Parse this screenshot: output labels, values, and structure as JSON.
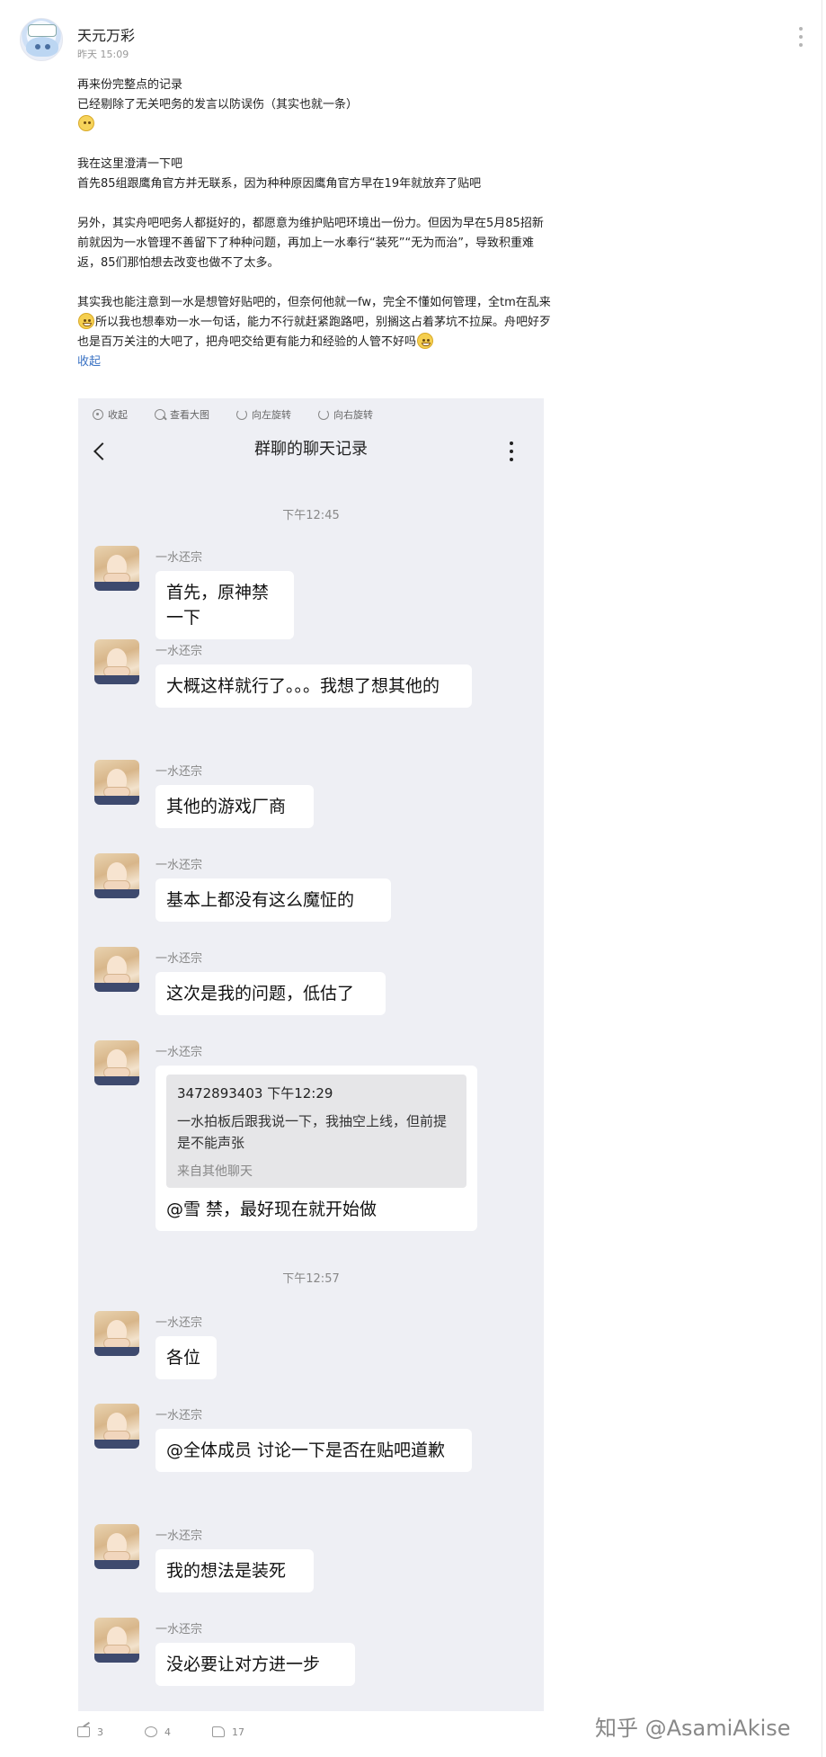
{
  "post": {
    "username": "天元万彩",
    "time": "昨天 15:09",
    "lines1": [
      "再来份完整点的记录",
      "已经剔除了无关吧务的发言以防误伤（其实也就一条）"
    ],
    "para2": [
      "我在这里澄清一下吧",
      "首先85组跟鹰角官方并无联系，因为种种原因鹰角官方早在19年就放弃了贴吧"
    ],
    "para3": "另外，其实舟吧吧务人都挺好的，都愿意为维护贴吧环境出一份力。但因为早在5月85招新前就因为一水管理不善留下了种种问题，再加上一水奉行“装死”“无为而治”，导致积重难返，85们那怕想去改变也做不了太多。",
    "para4_a": "其实我也能注意到一水是想管好贴吧的，但奈何他就一fw，完全不懂如何管理，全tm在乱来",
    "para4_b": "所以我也想奉劝一水一句话，能力不行就赶紧跑路吧，别搁这占着茅坑不拉屎。舟吧好歹也是百万关注的大吧了，把舟吧交给更有能力和经验的人管不好吗",
    "collapse": "收起"
  },
  "viewer": {
    "toolbar": [
      "收起",
      "查看大图",
      "向左旋转",
      "向右旋转"
    ],
    "chat_title": "群聊的聊天记录"
  },
  "chat": {
    "timestamps": [
      "下午12:45",
      "下午12:57"
    ],
    "sender": "一水还宗",
    "messages": [
      "首先，原神禁一下",
      "大概这样就行了。。。我想了想其他的",
      "其他的游戏厂商",
      "基本上都没有这么魔怔的",
      "这次是我的问题，低估了",
      "@雪 禁，最好现在就开始做",
      "各位",
      "@全体成员 讨论一下是否在贴吧道歉",
      "我的想法是装死",
      "没必要让对方进一步"
    ],
    "quote": {
      "head": "3472893403 下午12:29",
      "body": "一水拍板后跟我说一下，我抽空上线，但前提是不能声张",
      "source": "来自其他聊天"
    }
  },
  "footer": {
    "share_count": "3",
    "comment_count": "4",
    "like_count": "17"
  },
  "watermark": "知乎 @AsamiAkise"
}
